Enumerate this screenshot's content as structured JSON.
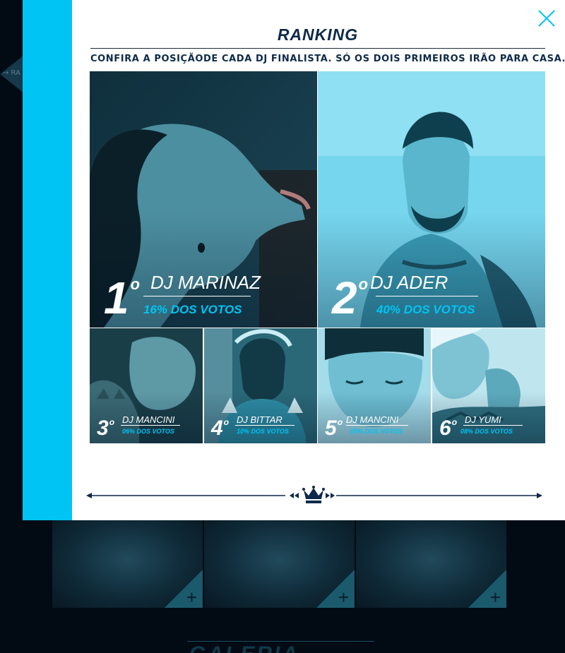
{
  "background": {
    "arrow_label": "→ RA",
    "section_title": "GALERIA"
  },
  "modal": {
    "title": "RANKING",
    "subtitle": "CONFIRA A POSIÇÃODE CADA DJ FINALISTA. SÓ OS DOIS PRIMEIROS IRÃO PARA CASA.",
    "close_icon": "close-x-icon",
    "footer_icon": "crown-icon",
    "accent_color": "#00c4f4",
    "text_color": "#0e2a4a"
  },
  "ranking": [
    {
      "place": "1",
      "ordinal": "o",
      "name": "DJ MARINAZ",
      "votes": "16% DOS VOTOS"
    },
    {
      "place": "2",
      "ordinal": "o",
      "name": "DJ ADER",
      "votes": "40% DOS VOTOS"
    },
    {
      "place": "3",
      "ordinal": "o",
      "name": "DJ MANCINI",
      "votes": "06% DOS VOTOS"
    },
    {
      "place": "4",
      "ordinal": "o",
      "name": "DJ BITTAR",
      "votes": "10% DOS VOTOS"
    },
    {
      "place": "5",
      "ordinal": "o",
      "name": "DJ MANCINI",
      "votes": "05% DOS VOTOS"
    },
    {
      "place": "6",
      "ordinal": "o",
      "name": "DJ YUMI",
      "votes": "08% DOS VOTOS"
    }
  ]
}
